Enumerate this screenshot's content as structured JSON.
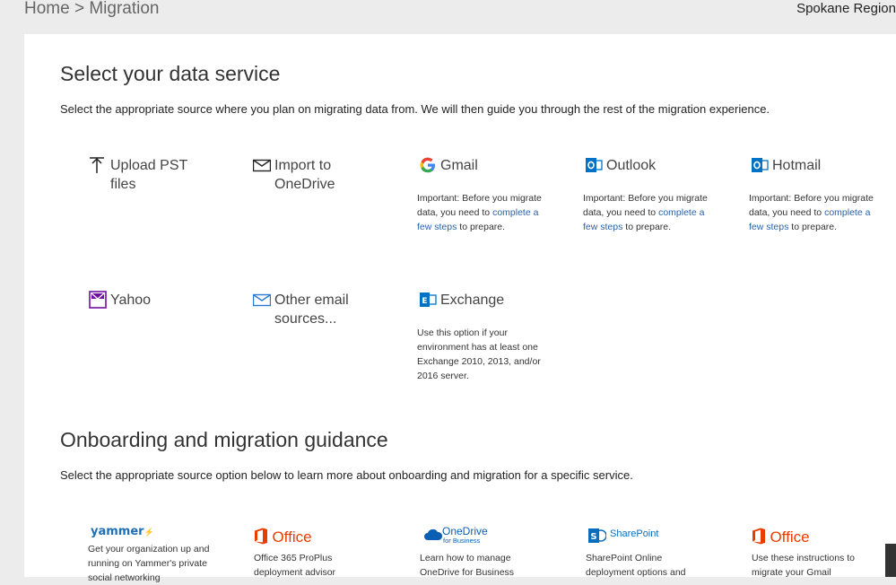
{
  "breadcrumb": {
    "home": "Home",
    "separator": ">",
    "current": "Migration"
  },
  "region": "Spokane Region",
  "section1": {
    "title": "Select your data service",
    "description": "Select the appropriate source where you plan on migrating data from. We will then guide you through the rest of the migration experience."
  },
  "services": [
    {
      "label": "Upload PST files",
      "icon": "upload-icon"
    },
    {
      "label": "Import to OneDrive",
      "icon": "envelope-icon"
    },
    {
      "label": "Gmail",
      "icon": "google-icon",
      "note_pre": "Important: Before you migrate data, you need to",
      "note_link": "complete a few steps",
      "note_post": "to prepare."
    },
    {
      "label": "Outlook",
      "icon": "outlook-icon",
      "note_pre": "Important: Before you migrate data, you need to",
      "note_link": "complete a few steps",
      "note_post": "to prepare."
    },
    {
      "label": "Hotmail",
      "icon": "outlook-icon",
      "note_pre": "Important: Before you migrate data, you need to",
      "note_link": "complete a few steps",
      "note_post": "to prepare."
    },
    {
      "label": "Yahoo",
      "icon": "yahoo-icon"
    },
    {
      "label": "Other email sources...",
      "icon": "mail-icon"
    },
    {
      "label": "Exchange",
      "icon": "exchange-icon",
      "note": "Use this option if your environment has at least one Exchange 2010, 2013, and/or 2016 server."
    }
  ],
  "section2": {
    "title": "Onboarding and migration guidance",
    "description": "Select the appropriate source option below to learn more about onboarding and migration for a specific service."
  },
  "guides": [
    {
      "logo": "yammer",
      "text": "Get your organization up and running on Yammer's private social networking"
    },
    {
      "logo": "Office",
      "text": "Office 365 ProPlus deployment advisor"
    },
    {
      "logo_line1": "OneDrive",
      "logo_line2": "for Business",
      "text": "Learn how to manage OneDrive for Business"
    },
    {
      "logo": "SharePoint",
      "text": "SharePoint Online deployment options and"
    },
    {
      "logo": "Office",
      "text": "Use these instructions to migrate your Gmail"
    }
  ],
  "colors": {
    "link": "#2a62a8",
    "office_orange": "#eb3c00",
    "outlook_blue": "#0072c6",
    "yahoo_purple": "#720e9e"
  }
}
